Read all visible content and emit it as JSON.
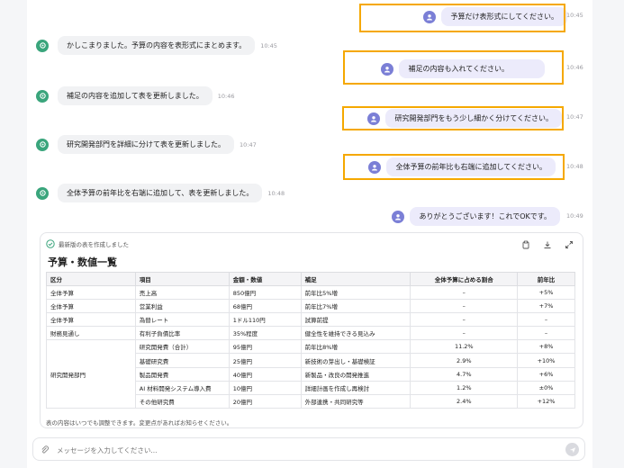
{
  "messages": [
    {
      "role": "user",
      "text": "予算だけ表形式にしてください。",
      "time": "10:45"
    },
    {
      "role": "assistant",
      "text": "かしこまりました。予算の内容を表形式にまとめます。",
      "time": "10:45"
    },
    {
      "role": "user",
      "text": "補足の内容も入れてください。",
      "time": "10:46"
    },
    {
      "role": "assistant",
      "text": "補足の内容を追加して表を更新しました。",
      "time": "10:46"
    },
    {
      "role": "user",
      "text": "研究開発部門をもう少し細かく分けてください。",
      "time": "10:47"
    },
    {
      "role": "assistant",
      "text": "研究開発部門を詳細に分けて表を更新しました。",
      "time": "10:47"
    },
    {
      "role": "user",
      "text": "全体予算の前年比も右端に追加してください。",
      "time": "10:48"
    },
    {
      "role": "assistant",
      "text": "全体予算の前年比を右端に追加して、表を更新しました。",
      "time": "10:48"
    },
    {
      "role": "user",
      "text": "ありがとうございます！これでOKです。",
      "time": "10:49"
    }
  ],
  "card": {
    "status": "最新版の表を作成しました",
    "title": "予算・数値一覧",
    "footnote": "表の内容はいつでも調整できます。変更点があればお知らせください。",
    "icons": [
      "copy-icon",
      "download-icon",
      "expand-icon"
    ]
  },
  "table": {
    "headers": [
      "区分",
      "項目",
      "金額・数値",
      "補足",
      "全体予算に占める割合",
      "前年比"
    ],
    "rows": [
      {
        "category": "全体予算",
        "item": "売上高",
        "amount": "850億円",
        "note": "前年比5%増",
        "share": "–",
        "yoy": "+5%"
      },
      {
        "category": "全体予算",
        "item": "営業利益",
        "amount": "68億円",
        "note": "前年比7%増",
        "share": "–",
        "yoy": "+7%"
      },
      {
        "category": "全体予算",
        "item": "為替レート",
        "amount": "1ドル110円",
        "note": "試算前提",
        "share": "–",
        "yoy": "–"
      },
      {
        "category": "財務見通し",
        "item": "有利子負債比率",
        "amount": "35%程度",
        "note": "健全性を維持できる見込み",
        "share": "–",
        "yoy": "–"
      },
      {
        "category": "",
        "item": "研究開発費（合計）",
        "amount": "95億円",
        "note": "前年比8%増",
        "share": "11.2%",
        "yoy": "+8%"
      },
      {
        "category": "",
        "item": "基礎研究費",
        "amount": "25億円",
        "note": "新技術の芽出し・基礎検証",
        "share": "2.9%",
        "yoy": "+10%"
      },
      {
        "category": "研究開発部門",
        "item": "製品開発費",
        "amount": "40億円",
        "note": "新製品・改良の開発推進",
        "share": "4.7%",
        "yoy": "+6%"
      },
      {
        "category": "",
        "item": "AI 材料開発システム導入費",
        "amount": "10億円",
        "note": "詳細計画を作成し再検討",
        "share": "1.2%",
        "yoy": "±0%"
      },
      {
        "category": "",
        "item": "その他研究費",
        "amount": "20億円",
        "note": "外部連携・共同研究等",
        "share": "2.4%",
        "yoy": "+12%"
      }
    ]
  },
  "input": {
    "placeholder": "メッセージを入力してください..."
  },
  "colors": {
    "highlight": "#f5a800",
    "assistant_avatar": "#3aa57c",
    "user_avatar": "#7b7fd6",
    "user_bubble": "#ecebfb"
  }
}
